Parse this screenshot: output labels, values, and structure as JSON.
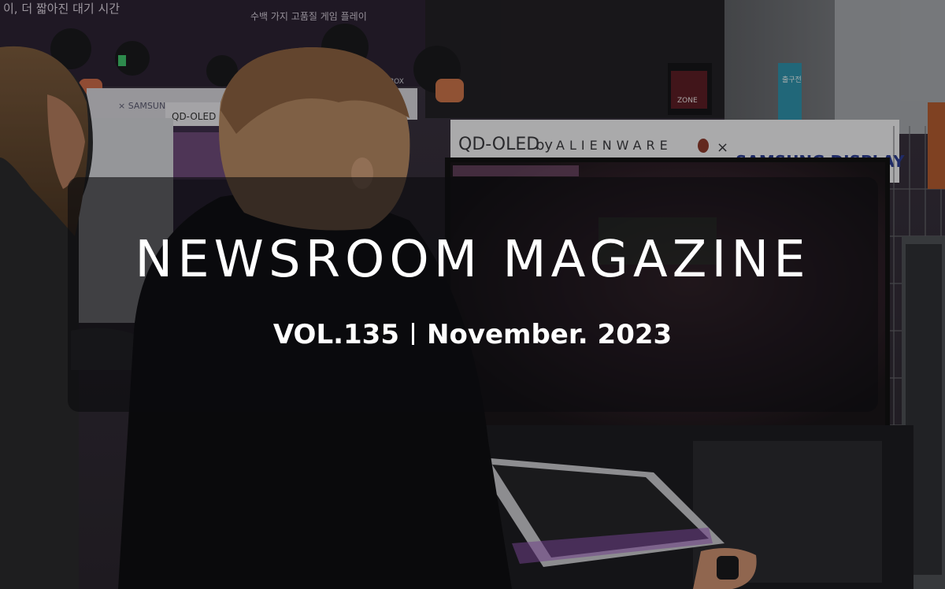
{
  "magazine": {
    "title": "NEWSROOM MAGAZINE",
    "volume": "VOL.135",
    "date": "November. 2023"
  },
  "background_signage": {
    "top_banner_left": "이, 더 짧아진 대기 시간",
    "top_banner_mid": "수백 가지 고품질 게임 플레이",
    "monitor_sign_left_brand": "QD-OLED",
    "monitor_sign_by": "by",
    "monitor_sign_alienware": "ALIENWARE",
    "monitor_sign_x": "×",
    "monitor_sign_samsung": "SAMSUNG DISPLAY",
    "small_sign_left": "QD-OLED",
    "small_sign_samsung": "× SAMSUNG DISPLAY",
    "rog_zone": "ZONE",
    "exit_sign": "출구전",
    "xbox_label": "XBOX"
  },
  "colors": {
    "overlay": "#0c0c0e",
    "text": "#ffffff",
    "samsung_blue": "#2b3c8f"
  }
}
